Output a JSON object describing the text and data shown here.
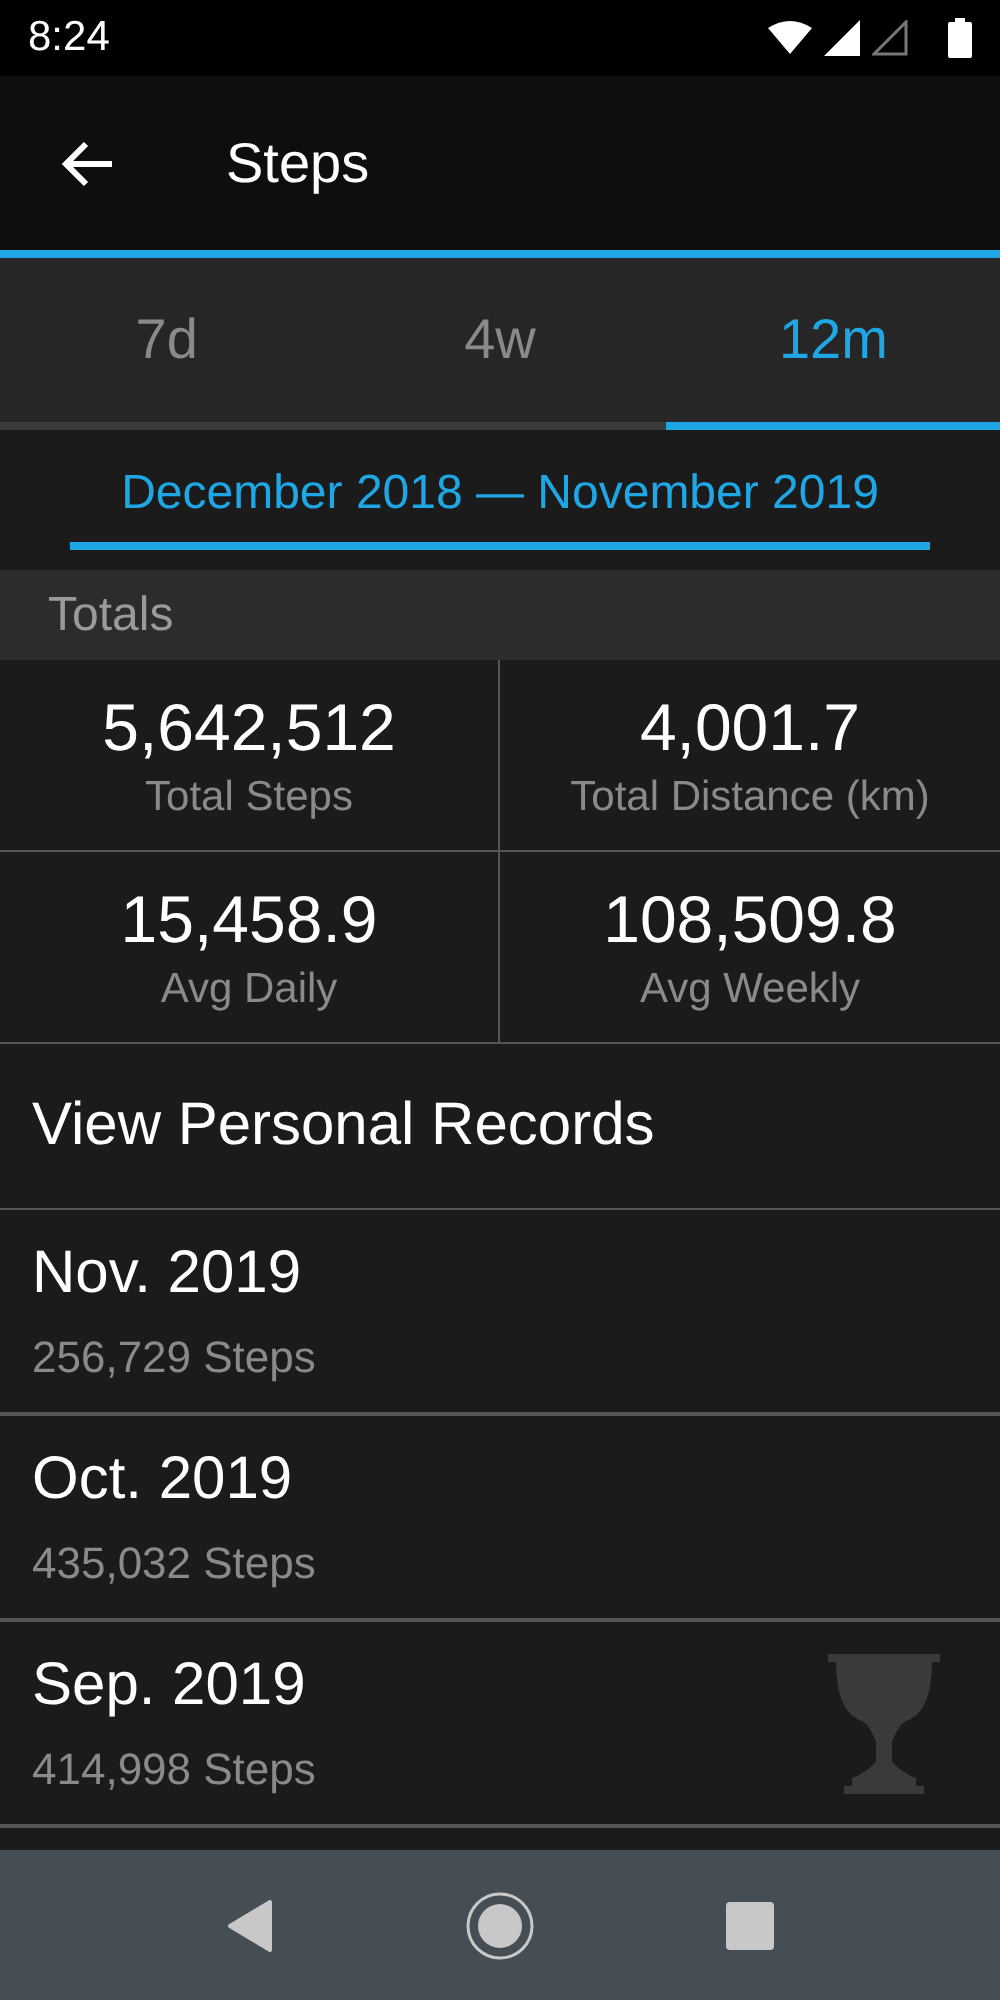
{
  "status_bar": {
    "time": "8:24"
  },
  "app_bar": {
    "title": "Steps"
  },
  "tabs": [
    {
      "label": "7d",
      "selected": false
    },
    {
      "label": "4w",
      "selected": false
    },
    {
      "label": "12m",
      "selected": true
    }
  ],
  "date_range": "December 2018 — November 2019",
  "totals": {
    "header": "Totals",
    "stats": [
      {
        "value": "5,642,512",
        "label": "Total Steps"
      },
      {
        "value": "4,001.7",
        "label": "Total Distance (km)"
      },
      {
        "value": "15,458.9",
        "label": "Avg Daily"
      },
      {
        "value": "108,509.8",
        "label": "Avg Weekly"
      }
    ]
  },
  "records_link": "View Personal Records",
  "months": [
    {
      "month": "Nov. 2019",
      "steps": "256,729 Steps",
      "record": false
    },
    {
      "month": "Oct. 2019",
      "steps": "435,032 Steps",
      "record": false
    },
    {
      "month": "Sep. 2019",
      "steps": "414,998 Steps",
      "record": true
    }
  ]
}
